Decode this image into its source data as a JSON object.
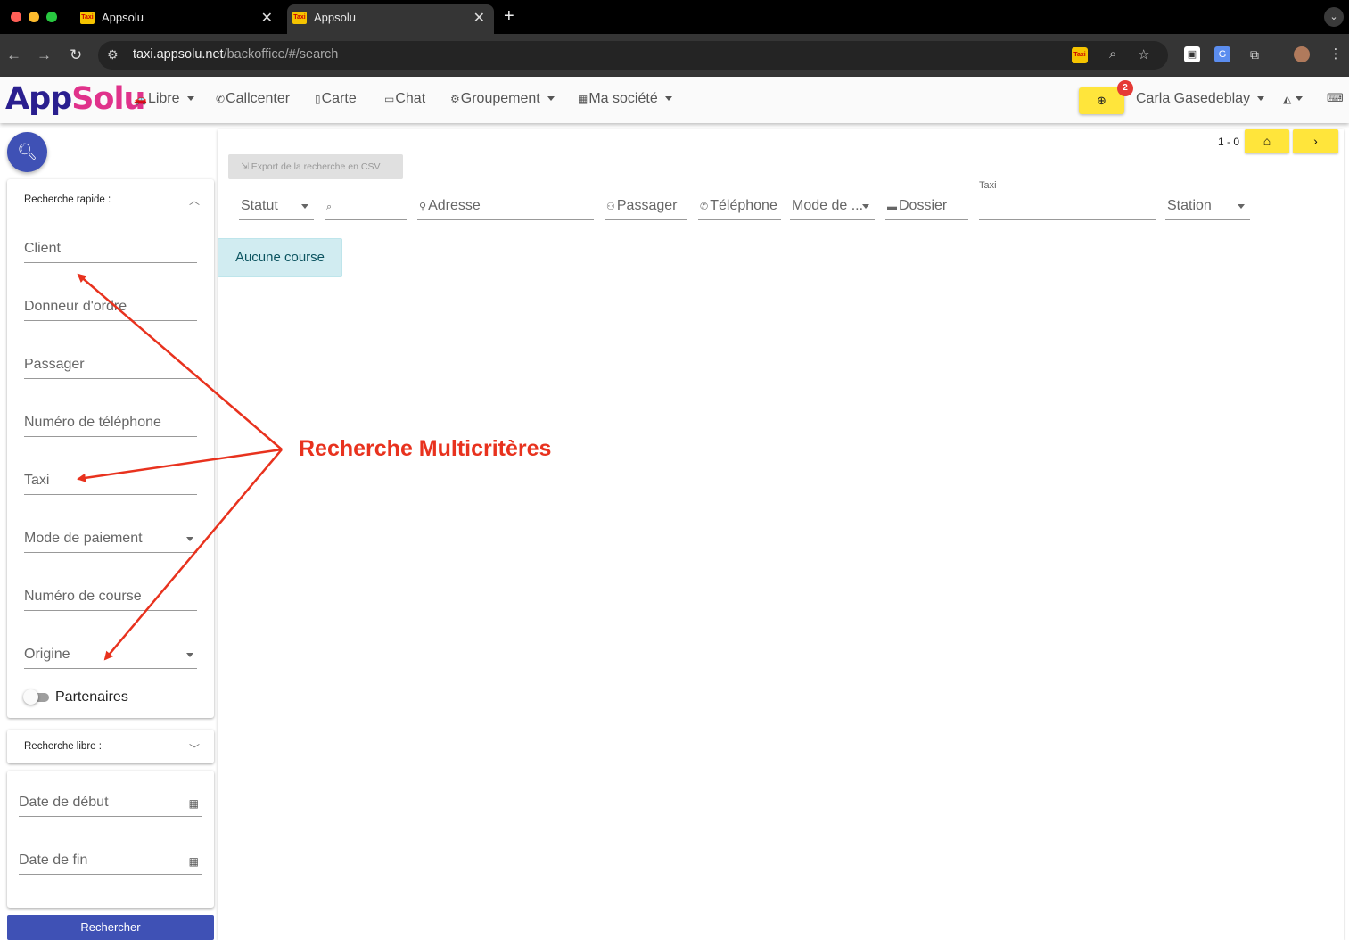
{
  "browser": {
    "tabs": [
      {
        "title": "Appsolu",
        "favicon": "Taxi",
        "active": false
      },
      {
        "title": "Appsolu",
        "favicon": "Taxi",
        "active": true
      }
    ],
    "url_host": "taxi.appsolu.net",
    "url_path": "/backoffice/#/search"
  },
  "app": {
    "logo_part1": "App",
    "logo_part2": "Solu",
    "menu": [
      {
        "label": "Libre",
        "icon": "car-icon",
        "has_dropdown": true
      },
      {
        "label": "Callcenter",
        "icon": "phone-icon",
        "has_dropdown": false
      },
      {
        "label": "Carte",
        "icon": "map-icon",
        "has_dropdown": false
      },
      {
        "label": "Chat",
        "icon": "chat-icon",
        "has_dropdown": false
      },
      {
        "label": "Groupement",
        "icon": "group-icon",
        "has_dropdown": true
      },
      {
        "label": "Ma société",
        "icon": "company-icon",
        "has_dropdown": true
      }
    ],
    "notif_count": "2",
    "user_name": "Carla Gasedeblay"
  },
  "sidebar": {
    "quick_title": "Recherche rapide :",
    "quick_fields": [
      {
        "label": "Client",
        "type": "text"
      },
      {
        "label": "Donneur d'ordre",
        "type": "text"
      },
      {
        "label": "Passager",
        "type": "text"
      },
      {
        "label": "Numéro de téléphone",
        "type": "text"
      },
      {
        "label": "Taxi",
        "type": "text"
      },
      {
        "label": "Mode de paiement",
        "type": "select"
      },
      {
        "label": "Numéro de course",
        "type": "text"
      },
      {
        "label": "Origine",
        "type": "select"
      }
    ],
    "partners_label": "Partenaires",
    "partners_on": false,
    "free_title": "Recherche libre :",
    "date_start": "Date de début",
    "date_end": "Date de fin",
    "search_button": "Rechercher"
  },
  "main": {
    "pager": "1 - 0",
    "export_label": "Export de la recherche en CSV",
    "filters": {
      "statut": "Statut",
      "adresse": "Adresse",
      "passager": "Passager",
      "telephone": "Téléphone",
      "mode": "Mode de ...",
      "dossier": "Dossier",
      "taxi": "Taxi",
      "station": "Station"
    },
    "empty_message": "Aucune course"
  },
  "annotation": {
    "text": "Recherche Multicritères",
    "color": "#e8321e"
  },
  "colors": {
    "primary": "#3f51b5",
    "accent_yellow": "#ffe53b",
    "info_bg": "#d1ecf1"
  }
}
